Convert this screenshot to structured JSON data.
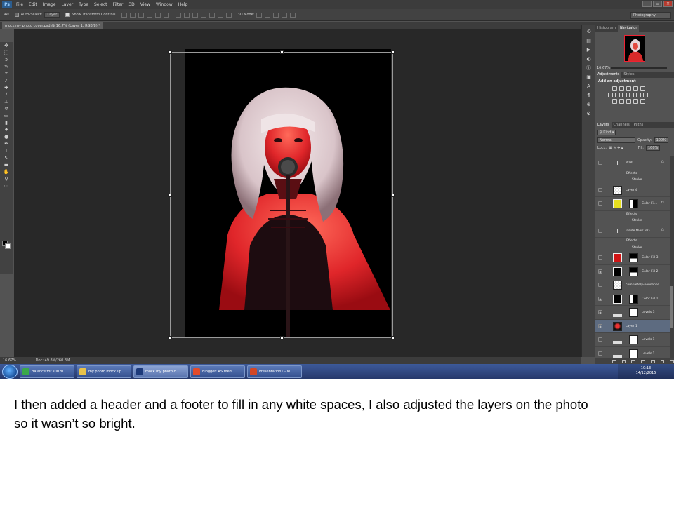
{
  "app": {
    "logo": "Ps"
  },
  "menu": [
    "File",
    "Edit",
    "Image",
    "Layer",
    "Type",
    "Select",
    "Filter",
    "3D",
    "View",
    "Window",
    "Help"
  ],
  "window_buttons": [
    "–",
    "▭",
    "✕"
  ],
  "options": {
    "auto_select_label": "Auto-Select:",
    "auto_select_value": "Layer",
    "show_transform_label": "Show Transform Controls",
    "mode_3d_label": "3D Mode:",
    "workspace": "Photography"
  },
  "document_tab": "mock my photo cover.psd @ 16.7% (Layer 1, RGB/8) *",
  "status": {
    "zoom": "16.67%",
    "doc": "Doc: 49.8M/260.3M"
  },
  "panels": {
    "nav_tabs": [
      "Histogram",
      "Navigator"
    ],
    "nav_zoom": "16.67%",
    "adj_tabs": [
      "Adjustments",
      "Styles"
    ],
    "adj_title": "Add an adjustment",
    "layer_tabs": [
      "Layers",
      "Channels",
      "Paths"
    ],
    "kind_label": "Kind",
    "blend_mode": "Normal",
    "opacity_label": "Opacity:",
    "opacity_value": "100%",
    "lock_label": "Lock:",
    "fill_label": "Fill:",
    "fill_value": "100%"
  },
  "layers": [
    {
      "name": "WIN!",
      "type": "text",
      "fx": true,
      "visible": false
    },
    {
      "name": "Effects",
      "type": "sub"
    },
    {
      "name": "Stroke",
      "type": "sub2"
    },
    {
      "name": "Layer 4",
      "type": "checker",
      "visible": false
    },
    {
      "name": "Color Fil...",
      "type": "fill",
      "color": "#e8e020",
      "mask": "white-black",
      "fx": true,
      "visible": false
    },
    {
      "name": "Effects",
      "type": "sub"
    },
    {
      "name": "Stroke",
      "type": "sub2"
    },
    {
      "name": "Inside their BIG...",
      "type": "text",
      "fx": true,
      "visible": false
    },
    {
      "name": "Effects",
      "type": "sub"
    },
    {
      "name": "Stroke",
      "type": "sub2"
    },
    {
      "name": "Color Fill 3",
      "type": "fill",
      "color": "#d11515",
      "mask": "black-white",
      "visible": false
    },
    {
      "name": "Color Fill 2",
      "type": "fill",
      "color": "#000000",
      "mask": "black-white",
      "visible": true
    },
    {
      "name": "completely-nonsense....",
      "type": "checker",
      "visible": false
    },
    {
      "name": "Color Fill 1",
      "type": "fill",
      "color": "#000000",
      "mask": "white-black",
      "visible": true
    },
    {
      "name": "Levels 3",
      "type": "levels",
      "visible": true
    },
    {
      "name": "Layer 1",
      "type": "photo",
      "selected": true,
      "visible": true
    },
    {
      "name": "Levels 1",
      "type": "levels",
      "visible": false
    },
    {
      "name": "Levels 1",
      "type": "levels",
      "visible": false
    }
  ],
  "taskbar": [
    {
      "label": "Balance for s0020...",
      "color": "#3aa84a"
    },
    {
      "label": "my photo mock up",
      "color": "#e8c24a"
    },
    {
      "label": "mock my photo c...",
      "color": "#1d3a7a",
      "active": true
    },
    {
      "label": "Blogger: AS medi...",
      "color": "#e24b2a"
    },
    {
      "label": "Presentation1 - M...",
      "color": "#d24726"
    }
  ],
  "clock": {
    "time": "10:13",
    "date": "14/12/2015"
  },
  "caption": "I then added a header and a footer to fill in any white spaces, I also adjusted the layers on the photo so it wasn’t so bright."
}
